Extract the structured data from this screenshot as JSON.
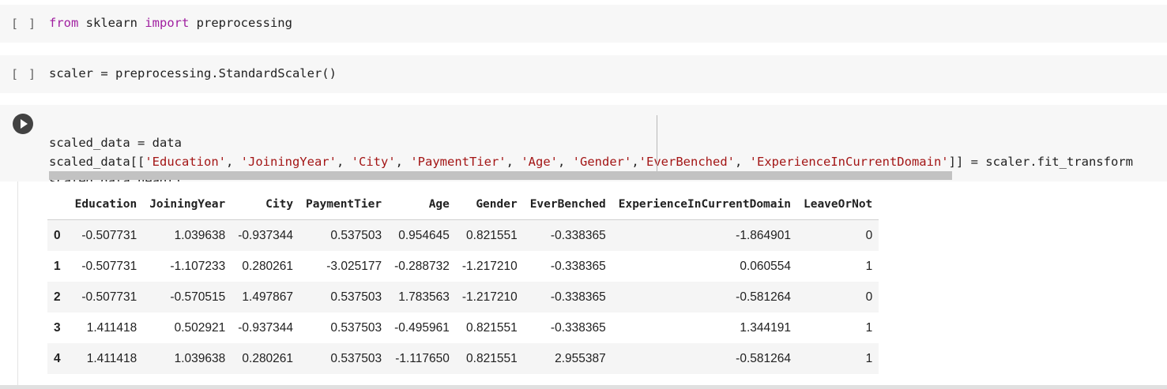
{
  "cells": [
    {
      "bracket": "[ ]",
      "code_tokens": {
        "kw1": "from",
        "t1": " sklearn ",
        "kw2": "import",
        "t2": " preprocessing"
      }
    },
    {
      "bracket": "[ ]",
      "code": "scaler = preprocessing.StandardScaler()"
    },
    {
      "line1": "scaled_data = data",
      "line2": {
        "pre": "scaled_data[[",
        "s1": "'Education'",
        "s2": "'JoiningYear'",
        "s3": "'City'",
        "s4": "'PaymentTier'",
        "s5": "'Age'",
        "s6": "'Gender'",
        "s7": "'EverBenched'",
        "s8": "'ExperienceInCurrentDomain'",
        "post": "]] = scaler.fit_transform"
      },
      "line3": "scaled_data.head()"
    }
  ],
  "table": {
    "columns": [
      "Education",
      "JoiningYear",
      "City",
      "PaymentTier",
      "Age",
      "Gender",
      "EverBenched",
      "ExperienceInCurrentDomain",
      "LeaveOrNot"
    ],
    "rows": [
      {
        "index": "0",
        "values": [
          "-0.507731",
          "1.039638",
          "-0.937344",
          "0.537503",
          "0.954645",
          "0.821551",
          "-0.338365",
          "-1.864901",
          "0"
        ]
      },
      {
        "index": "1",
        "values": [
          "-0.507731",
          "-1.107233",
          "0.280261",
          "-3.025177",
          "-0.288732",
          "-1.217210",
          "-0.338365",
          "0.060554",
          "1"
        ]
      },
      {
        "index": "2",
        "values": [
          "-0.507731",
          "-0.570515",
          "1.497867",
          "0.537503",
          "1.783563",
          "-1.217210",
          "-0.338365",
          "-0.581264",
          "0"
        ]
      },
      {
        "index": "3",
        "values": [
          "1.411418",
          "0.502921",
          "-0.937344",
          "0.537503",
          "-0.495961",
          "0.821551",
          "-0.338365",
          "1.344191",
          "1"
        ]
      },
      {
        "index": "4",
        "values": [
          "1.411418",
          "1.039638",
          "0.280261",
          "0.537503",
          "-1.117650",
          "0.821551",
          "2.955387",
          "-0.581264",
          "1"
        ]
      }
    ]
  }
}
